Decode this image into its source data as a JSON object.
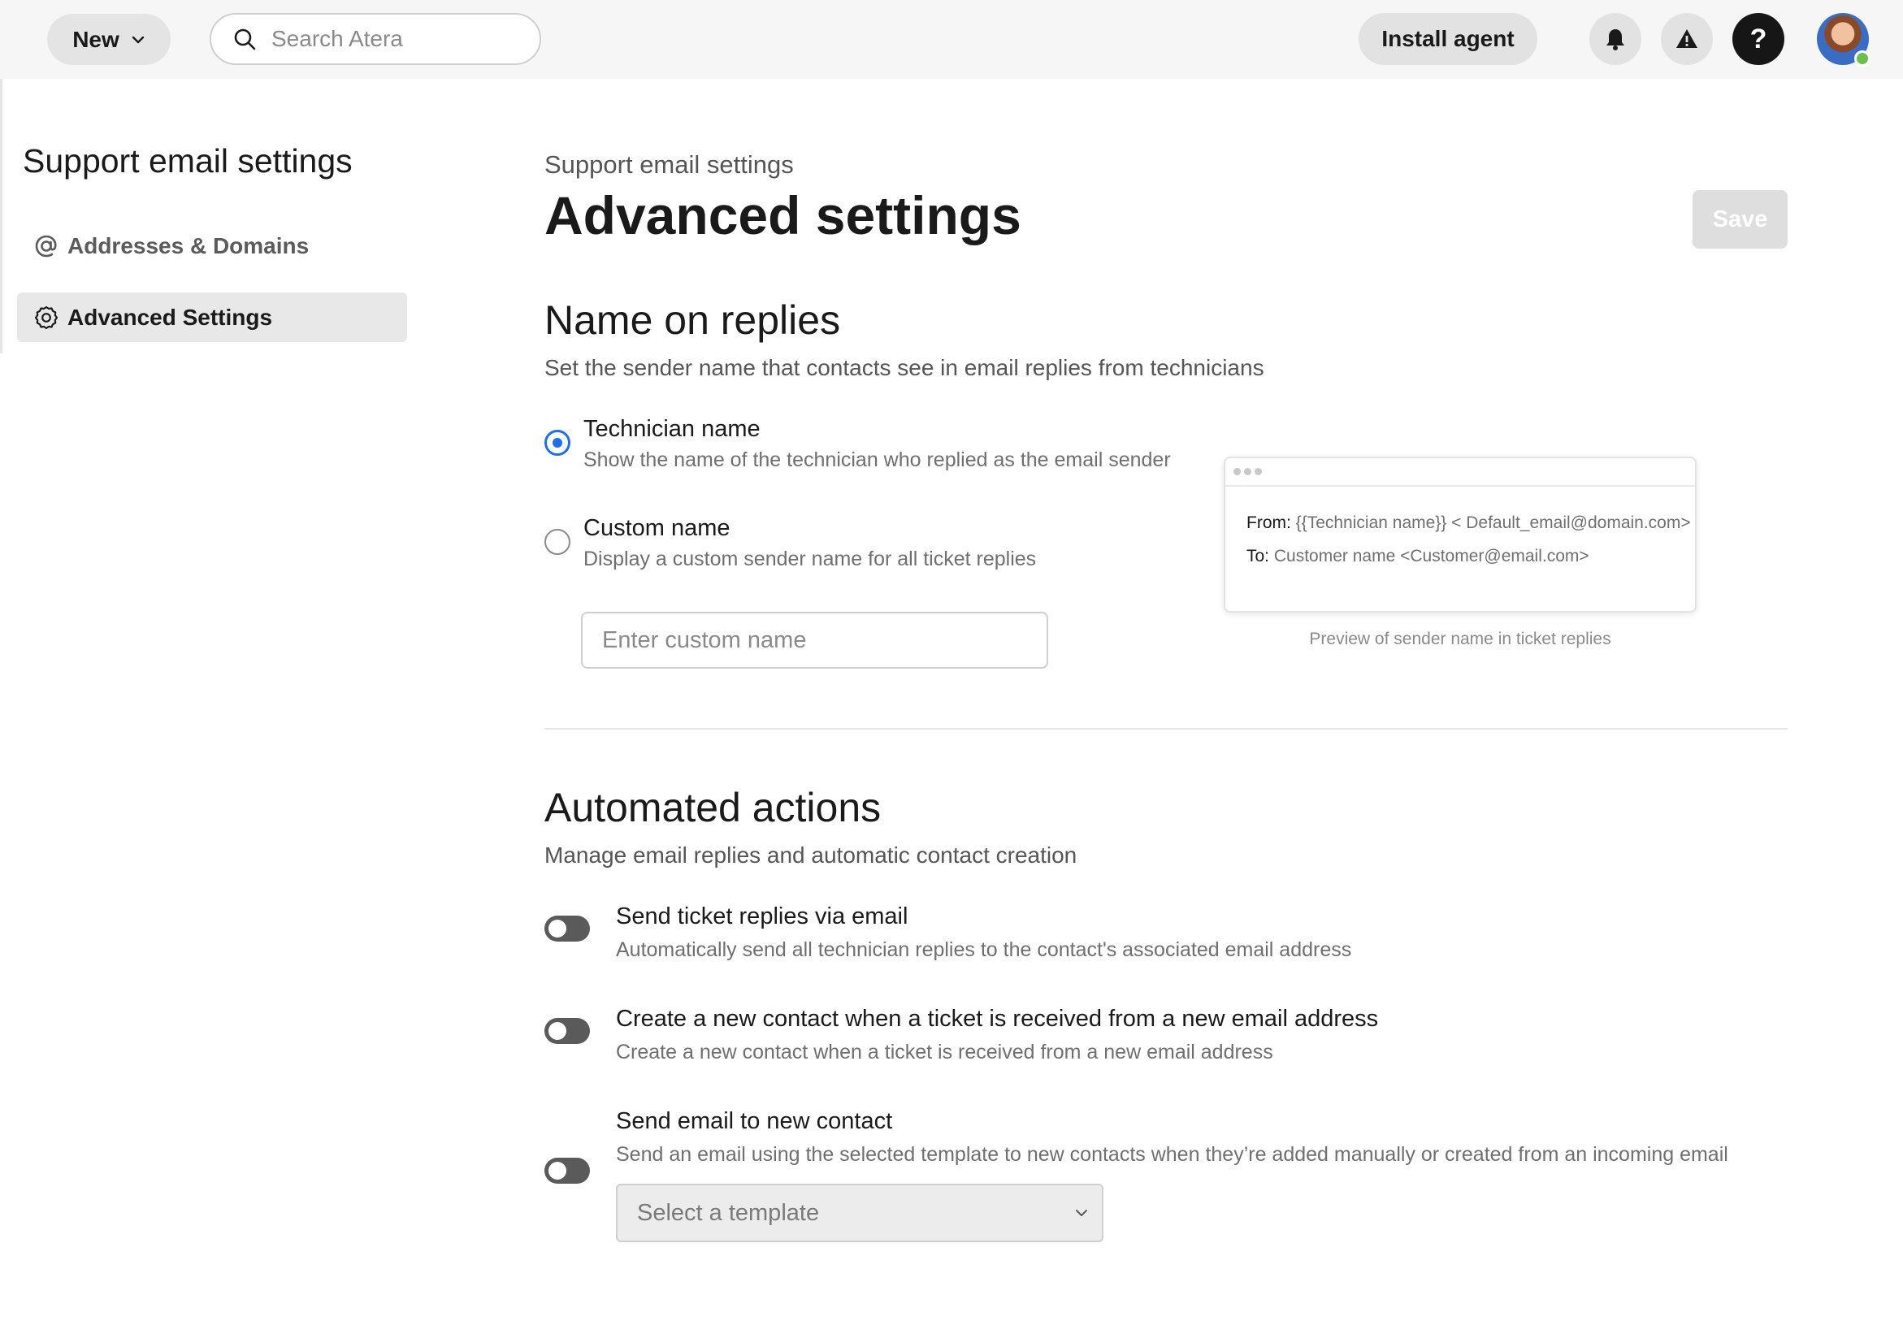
{
  "topbar": {
    "new_label": "New",
    "search_placeholder": "Search Atera",
    "install_label": "Install agent",
    "help_glyph": "?"
  },
  "sidebar": {
    "title": "Support email settings",
    "items": [
      {
        "label": "Addresses & Domains",
        "icon": "at-icon"
      },
      {
        "label": "Advanced Settings",
        "icon": "gear-icon"
      }
    ]
  },
  "main": {
    "breadcrumb": "Support email settings",
    "title": "Advanced settings",
    "save_label": "Save",
    "names": {
      "title": "Name on replies",
      "desc": "Set the sender name that contacts see in email replies from technicians",
      "options": [
        {
          "label": "Technician name",
          "sub": "Show the name of the technician who replied as the email sender",
          "checked": true
        },
        {
          "label": "Custom name",
          "sub": "Display a custom sender name for all ticket replies",
          "checked": false
        }
      ],
      "custom_placeholder": "Enter custom name",
      "preview": {
        "from_key": "From:",
        "from_val": "{{Technician name}} < Default_email@domain.com>",
        "to_key": "To:",
        "to_val": "Customer name <Customer@email.com>",
        "caption": "Preview of sender name in ticket replies"
      }
    },
    "automated": {
      "title": "Automated actions",
      "desc": "Manage email replies and automatic contact creation",
      "toggles": [
        {
          "label": "Send ticket replies via email",
          "sub": "Automatically send all technician replies to the contact's associated email address",
          "on": false
        },
        {
          "label": "Create a new contact when a ticket is received from a new email address",
          "sub": "Create a new contact when a ticket is received from a new email address",
          "on": false
        },
        {
          "label": "Send email to new contact",
          "sub": "Send an email using the selected template to new contacts when they’re added manually or created from an incoming email",
          "on": false
        }
      ],
      "template_placeholder": "Select a template"
    }
  },
  "colors": {
    "accent": "#1f6fe5",
    "toggle_off": "#5a5a5a",
    "status_online": "#6cc04a"
  }
}
